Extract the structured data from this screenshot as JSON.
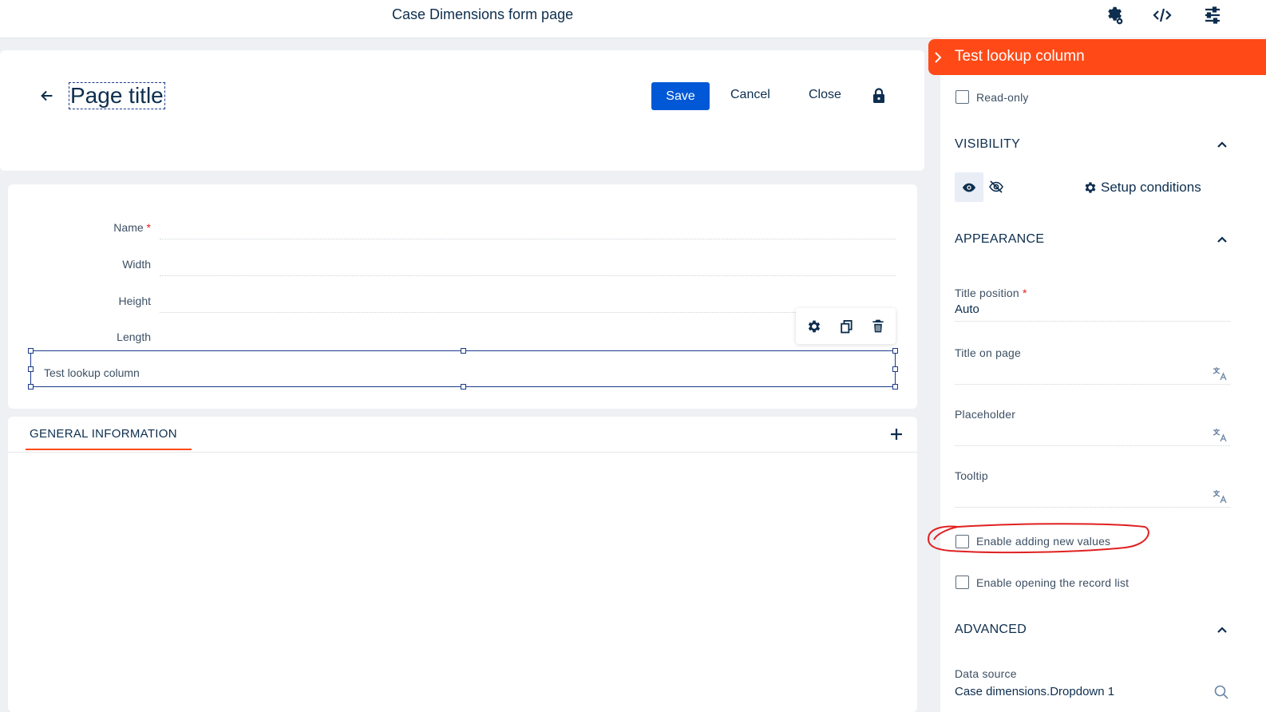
{
  "topbar": {
    "title": "Case Dimensions form page"
  },
  "header": {
    "page_title": "Page title",
    "save_label": "Save",
    "cancel_label": "Cancel",
    "close_label": "Close"
  },
  "form": {
    "fields": [
      {
        "label": "Name",
        "required": true
      },
      {
        "label": "Width"
      },
      {
        "label": "Height"
      },
      {
        "label": "Length"
      },
      {
        "label": "Test lookup column"
      }
    ]
  },
  "tabs": {
    "active_label": "GENERAL INFORMATION"
  },
  "panel": {
    "title": "Test lookup column",
    "readonly_label": "Read-only",
    "visibility_label": "VISIBILITY",
    "setup_conditions_label": "Setup conditions",
    "appearance_label": "APPEARANCE",
    "title_position_label": "Title position",
    "title_position_value": "Auto",
    "title_on_page_label": "Title on page",
    "placeholder_label": "Placeholder",
    "tooltip_label": "Tooltip",
    "enable_adding_label": "Enable adding new values",
    "enable_opening_label": "Enable opening the record list",
    "advanced_label": "ADVANCED",
    "data_source_label": "Data source",
    "data_source_value": "Case dimensions.Dropdown 1"
  },
  "colors": {
    "accent": "#ff4a17",
    "primary": "#0058d6",
    "text": "#0d2e4e",
    "annotation": "#e02020"
  }
}
